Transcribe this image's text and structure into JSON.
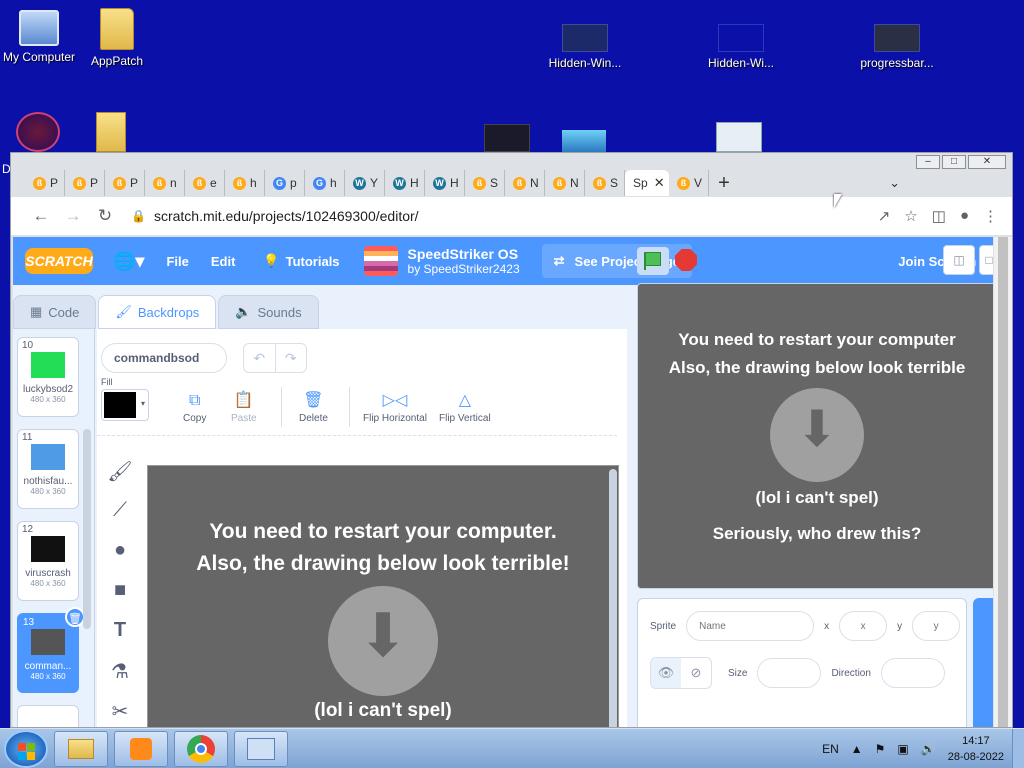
{
  "desktop": {
    "icons": [
      {
        "label": "My Computer"
      },
      {
        "label": "AppPatch"
      },
      {
        "label": "Hidden-Win..."
      },
      {
        "label": "Hidden-Wi..."
      },
      {
        "label": "progressbar..."
      },
      {
        "label": "D"
      }
    ]
  },
  "browser": {
    "tabs": [
      {
        "icon": "scratch-icon",
        "text": "P"
      },
      {
        "icon": "scratch-icon",
        "text": "P"
      },
      {
        "icon": "scratch-icon",
        "text": "P"
      },
      {
        "icon": "scratch-icon",
        "text": "n"
      },
      {
        "icon": "scratch-icon",
        "text": "e"
      },
      {
        "icon": "scratch-icon",
        "text": "h"
      },
      {
        "icon": "google-icon",
        "text": "p"
      },
      {
        "icon": "google-icon",
        "text": "h"
      },
      {
        "icon": "wordpress-icon",
        "text": "Y"
      },
      {
        "icon": "wordpress-icon",
        "text": "H"
      },
      {
        "icon": "wordpress-icon",
        "text": "H"
      },
      {
        "icon": "scratch-icon",
        "text": "S"
      },
      {
        "icon": "scratch-icon",
        "text": "N"
      },
      {
        "icon": "scratch-icon",
        "text": "N"
      },
      {
        "icon": "scratch-icon",
        "text": "S"
      },
      {
        "icon": "scratch-icon",
        "text": "Sp",
        "active": true
      },
      {
        "icon": "scratch-icon",
        "text": "V"
      }
    ],
    "url": "scratch.mit.edu/projects/102469300/editor/",
    "win_controls": [
      "minimize",
      "maximize",
      "close"
    ]
  },
  "scratch": {
    "logo": "SCRATCH",
    "menu": {
      "file": "File",
      "edit": "Edit",
      "tutorials": "Tutorials"
    },
    "project": {
      "title": "SpeedStriker OS",
      "author": "by SpeedStriker2423"
    },
    "see_project": "See Project Page",
    "join": "Join Scratch",
    "signin_partial": "S",
    "tabs": {
      "code": "Code",
      "backdrops": "Backdrops",
      "sounds": "Sounds"
    },
    "costumes": [
      {
        "num": "10",
        "name": "luckybsod2",
        "size": "480 x 360",
        "color": "#22dd55"
      },
      {
        "num": "11",
        "name": "nothisfau...",
        "size": "480 x 360",
        "color": "#4f9be6"
      },
      {
        "num": "12",
        "name": "viruscrash",
        "size": "480 x 360",
        "color": "#111111"
      },
      {
        "num": "13",
        "name": "comman...",
        "size": "480 x 360",
        "color": "#555555",
        "selected": true
      }
    ],
    "editor": {
      "costume_name": "commandbsod",
      "fill_label": "Fill",
      "fill_color": "#000000",
      "copy": "Copy",
      "paste": "Paste",
      "delete": "Delete",
      "flip_h": "Flip Horizontal",
      "flip_v": "Flip Vertical"
    },
    "canvas_text": {
      "line1": "You need to restart your computer.",
      "line2": "Also, the drawing below look terrible!",
      "line3": "(lol i can't spel)",
      "line4": "Seriously, who drew this?"
    },
    "stage_text": {
      "line1": "You need to restart your computer",
      "line2": "Also, the drawing below look terrible",
      "line3": "(lol i can't spel)",
      "line4": "Seriously, who drew this?"
    },
    "sprite_panel": {
      "sprite_label": "Sprite",
      "name_placeholder": "Name",
      "x_label": "x",
      "x_placeholder": "x",
      "y_label": "y",
      "y_placeholder": "y",
      "size_label": "Size",
      "direction_label": "Direction"
    }
  },
  "taskbar": {
    "lang": "EN",
    "time": "14:17",
    "date": "28-08-2022"
  }
}
